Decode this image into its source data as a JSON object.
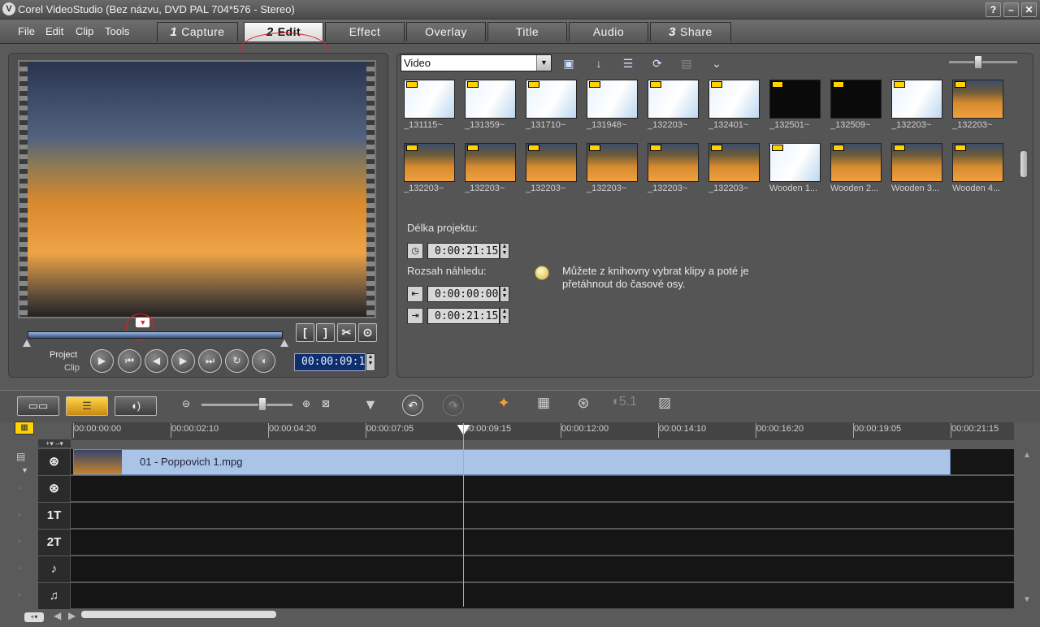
{
  "window": {
    "title": "Corel VideoStudio (Bez názvu, DVD PAL 704*576 - Stereo)",
    "help": "?",
    "minimize": "–",
    "close": "✕"
  },
  "menu": {
    "items": [
      "File",
      "Edit",
      "Clip",
      "Tools"
    ]
  },
  "steps": [
    {
      "num": "1",
      "label": "Capture"
    },
    {
      "num": "2",
      "label": "Edit"
    },
    {
      "num": "",
      "label": "Effect"
    },
    {
      "num": "",
      "label": "Overlay"
    },
    {
      "num": "",
      "label": "Title"
    },
    {
      "num": "",
      "label": "Audio"
    },
    {
      "num": "3",
      "label": "Share"
    }
  ],
  "preview": {
    "mode_project": "Project",
    "mode_clip": "Clip",
    "timecode": "00:00:09:15",
    "trim_in": "[",
    "trim_out": "]",
    "playback_progress": 0.45
  },
  "library": {
    "category": "Video",
    "thumbs_row1": [
      {
        "cap": "_131115~",
        "kind": "doc"
      },
      {
        "cap": "_131359~",
        "kind": "doc"
      },
      {
        "cap": "_131710~",
        "kind": "doc"
      },
      {
        "cap": "_131948~",
        "kind": "doc"
      },
      {
        "cap": "_132203~",
        "kind": "doc"
      },
      {
        "cap": "_132401~",
        "kind": "doc"
      },
      {
        "cap": "_132501~",
        "kind": "black"
      },
      {
        "cap": "_132509~",
        "kind": "black"
      },
      {
        "cap": "_132203~",
        "kind": "doc"
      },
      {
        "cap": "_132203~",
        "kind": "court"
      }
    ],
    "thumbs_row2": [
      {
        "cap": "_132203~",
        "kind": "court"
      },
      {
        "cap": "_132203~",
        "kind": "court"
      },
      {
        "cap": "_132203~",
        "kind": "court"
      },
      {
        "cap": "_132203~",
        "kind": "court"
      },
      {
        "cap": "_132203~",
        "kind": "court"
      },
      {
        "cap": "_132203~",
        "kind": "court"
      },
      {
        "cap": "Wooden 1...",
        "kind": "doc"
      },
      {
        "cap": "Wooden 2...",
        "kind": "court"
      },
      {
        "cap": "Wooden 3...",
        "kind": "court"
      },
      {
        "cap": "Wooden 4...",
        "kind": "court"
      }
    ]
  },
  "project_info": {
    "duration_label": "Délka projektu:",
    "duration_value": "0:00:21:15",
    "range_label": "Rozsah náhledu:",
    "range_start": "0:00:00:00",
    "range_end": "0:00:21:15",
    "hint": "Můžete z knihovny vybrat klipy a poté je přetáhnout do časové osy."
  },
  "timeline": {
    "ruler_ticks": [
      "00:00:00:00",
      "00:00:02:10",
      "00:00:04:20",
      "00:00:07:05",
      "00:00:09:15",
      "00:00:12:00",
      "00:00:14:10",
      "00:00:16:20",
      "00:00:19:05",
      "00:00:21:15"
    ],
    "clip_name": "01 - Poppovich 1.mpg",
    "tracks": [
      {
        "icon": "video-track-icon",
        "glyph": "⊛"
      },
      {
        "icon": "overlay-track-icon",
        "glyph": "⊛"
      },
      {
        "icon": "title-track-1-icon",
        "glyph": "1T"
      },
      {
        "icon": "title-track-2-icon",
        "glyph": "2T"
      },
      {
        "icon": "voice-track-icon",
        "glyph": "♪"
      },
      {
        "icon": "music-track-icon",
        "glyph": "♫"
      }
    ]
  }
}
